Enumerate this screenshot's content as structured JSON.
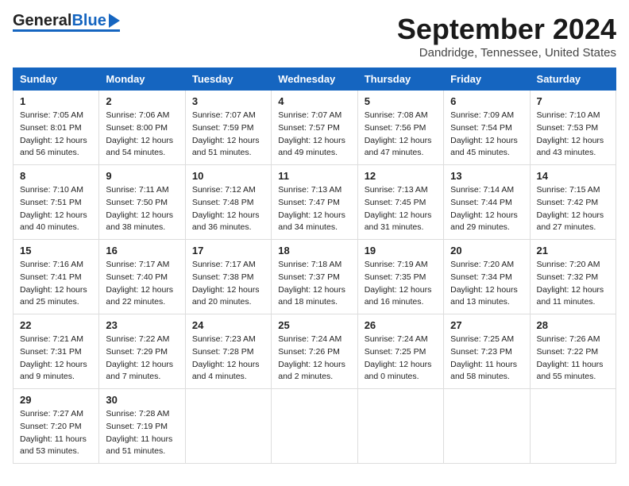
{
  "header": {
    "logo_general": "General",
    "logo_blue": "Blue",
    "month_title": "September 2024",
    "location": "Dandridge, Tennessee, United States"
  },
  "columns": [
    "Sunday",
    "Monday",
    "Tuesday",
    "Wednesday",
    "Thursday",
    "Friday",
    "Saturday"
  ],
  "weeks": [
    [
      {
        "day": "1",
        "sunrise": "Sunrise: 7:05 AM",
        "sunset": "Sunset: 8:01 PM",
        "daylight": "Daylight: 12 hours and 56 minutes."
      },
      {
        "day": "2",
        "sunrise": "Sunrise: 7:06 AM",
        "sunset": "Sunset: 8:00 PM",
        "daylight": "Daylight: 12 hours and 54 minutes."
      },
      {
        "day": "3",
        "sunrise": "Sunrise: 7:07 AM",
        "sunset": "Sunset: 7:59 PM",
        "daylight": "Daylight: 12 hours and 51 minutes."
      },
      {
        "day": "4",
        "sunrise": "Sunrise: 7:07 AM",
        "sunset": "Sunset: 7:57 PM",
        "daylight": "Daylight: 12 hours and 49 minutes."
      },
      {
        "day": "5",
        "sunrise": "Sunrise: 7:08 AM",
        "sunset": "Sunset: 7:56 PM",
        "daylight": "Daylight: 12 hours and 47 minutes."
      },
      {
        "day": "6",
        "sunrise": "Sunrise: 7:09 AM",
        "sunset": "Sunset: 7:54 PM",
        "daylight": "Daylight: 12 hours and 45 minutes."
      },
      {
        "day": "7",
        "sunrise": "Sunrise: 7:10 AM",
        "sunset": "Sunset: 7:53 PM",
        "daylight": "Daylight: 12 hours and 43 minutes."
      }
    ],
    [
      {
        "day": "8",
        "sunrise": "Sunrise: 7:10 AM",
        "sunset": "Sunset: 7:51 PM",
        "daylight": "Daylight: 12 hours and 40 minutes."
      },
      {
        "day": "9",
        "sunrise": "Sunrise: 7:11 AM",
        "sunset": "Sunset: 7:50 PM",
        "daylight": "Daylight: 12 hours and 38 minutes."
      },
      {
        "day": "10",
        "sunrise": "Sunrise: 7:12 AM",
        "sunset": "Sunset: 7:48 PM",
        "daylight": "Daylight: 12 hours and 36 minutes."
      },
      {
        "day": "11",
        "sunrise": "Sunrise: 7:13 AM",
        "sunset": "Sunset: 7:47 PM",
        "daylight": "Daylight: 12 hours and 34 minutes."
      },
      {
        "day": "12",
        "sunrise": "Sunrise: 7:13 AM",
        "sunset": "Sunset: 7:45 PM",
        "daylight": "Daylight: 12 hours and 31 minutes."
      },
      {
        "day": "13",
        "sunrise": "Sunrise: 7:14 AM",
        "sunset": "Sunset: 7:44 PM",
        "daylight": "Daylight: 12 hours and 29 minutes."
      },
      {
        "day": "14",
        "sunrise": "Sunrise: 7:15 AM",
        "sunset": "Sunset: 7:42 PM",
        "daylight": "Daylight: 12 hours and 27 minutes."
      }
    ],
    [
      {
        "day": "15",
        "sunrise": "Sunrise: 7:16 AM",
        "sunset": "Sunset: 7:41 PM",
        "daylight": "Daylight: 12 hours and 25 minutes."
      },
      {
        "day": "16",
        "sunrise": "Sunrise: 7:17 AM",
        "sunset": "Sunset: 7:40 PM",
        "daylight": "Daylight: 12 hours and 22 minutes."
      },
      {
        "day": "17",
        "sunrise": "Sunrise: 7:17 AM",
        "sunset": "Sunset: 7:38 PM",
        "daylight": "Daylight: 12 hours and 20 minutes."
      },
      {
        "day": "18",
        "sunrise": "Sunrise: 7:18 AM",
        "sunset": "Sunset: 7:37 PM",
        "daylight": "Daylight: 12 hours and 18 minutes."
      },
      {
        "day": "19",
        "sunrise": "Sunrise: 7:19 AM",
        "sunset": "Sunset: 7:35 PM",
        "daylight": "Daylight: 12 hours and 16 minutes."
      },
      {
        "day": "20",
        "sunrise": "Sunrise: 7:20 AM",
        "sunset": "Sunset: 7:34 PM",
        "daylight": "Daylight: 12 hours and 13 minutes."
      },
      {
        "day": "21",
        "sunrise": "Sunrise: 7:20 AM",
        "sunset": "Sunset: 7:32 PM",
        "daylight": "Daylight: 12 hours and 11 minutes."
      }
    ],
    [
      {
        "day": "22",
        "sunrise": "Sunrise: 7:21 AM",
        "sunset": "Sunset: 7:31 PM",
        "daylight": "Daylight: 12 hours and 9 minutes."
      },
      {
        "day": "23",
        "sunrise": "Sunrise: 7:22 AM",
        "sunset": "Sunset: 7:29 PM",
        "daylight": "Daylight: 12 hours and 7 minutes."
      },
      {
        "day": "24",
        "sunrise": "Sunrise: 7:23 AM",
        "sunset": "Sunset: 7:28 PM",
        "daylight": "Daylight: 12 hours and 4 minutes."
      },
      {
        "day": "25",
        "sunrise": "Sunrise: 7:24 AM",
        "sunset": "Sunset: 7:26 PM",
        "daylight": "Daylight: 12 hours and 2 minutes."
      },
      {
        "day": "26",
        "sunrise": "Sunrise: 7:24 AM",
        "sunset": "Sunset: 7:25 PM",
        "daylight": "Daylight: 12 hours and 0 minutes."
      },
      {
        "day": "27",
        "sunrise": "Sunrise: 7:25 AM",
        "sunset": "Sunset: 7:23 PM",
        "daylight": "Daylight: 11 hours and 58 minutes."
      },
      {
        "day": "28",
        "sunrise": "Sunrise: 7:26 AM",
        "sunset": "Sunset: 7:22 PM",
        "daylight": "Daylight: 11 hours and 55 minutes."
      }
    ],
    [
      {
        "day": "29",
        "sunrise": "Sunrise: 7:27 AM",
        "sunset": "Sunset: 7:20 PM",
        "daylight": "Daylight: 11 hours and 53 minutes."
      },
      {
        "day": "30",
        "sunrise": "Sunrise: 7:28 AM",
        "sunset": "Sunset: 7:19 PM",
        "daylight": "Daylight: 11 hours and 51 minutes."
      },
      null,
      null,
      null,
      null,
      null
    ]
  ]
}
